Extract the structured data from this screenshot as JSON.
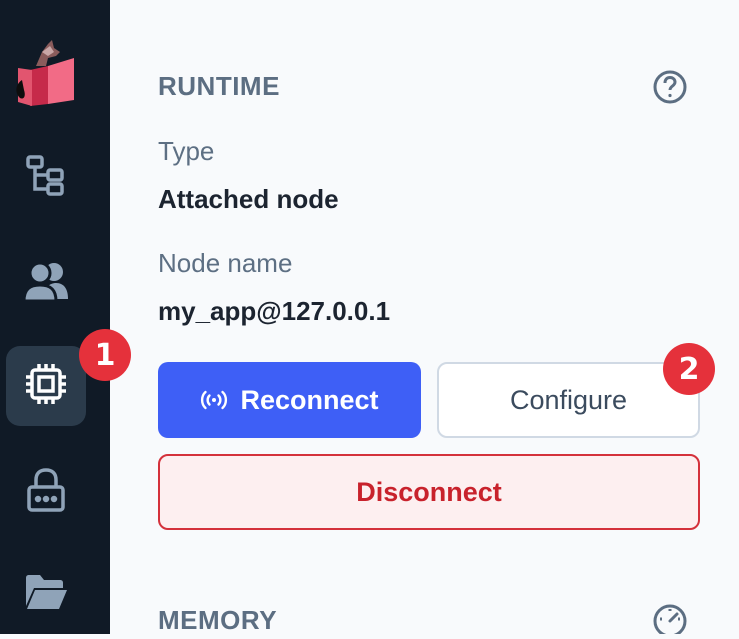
{
  "sidebar": {
    "items": [
      {
        "name": "logo"
      },
      {
        "name": "hierarchy-icon"
      },
      {
        "name": "users-icon"
      },
      {
        "name": "chip-icon",
        "active": true
      },
      {
        "name": "lock-icon"
      },
      {
        "name": "folder-icon"
      }
    ]
  },
  "annotations": {
    "badge1": "1",
    "badge2": "2"
  },
  "runtime": {
    "title": "RUNTIME",
    "type_label": "Type",
    "type_value": "Attached node",
    "node_label": "Node name",
    "node_value": "my_app@127.0.0.1",
    "reconnect_label": "Reconnect",
    "configure_label": "Configure",
    "disconnect_label": "Disconnect"
  },
  "memory": {
    "title": "MEMORY"
  },
  "colors": {
    "accent": "#3e5ff6",
    "danger": "#c8222c",
    "badge": "#e5313b",
    "sidebar": "#101a26"
  }
}
